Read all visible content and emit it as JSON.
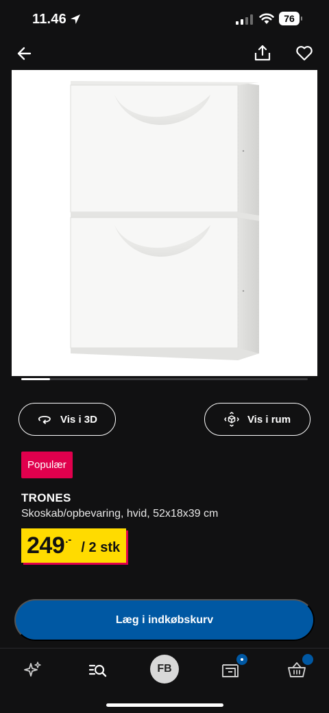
{
  "status": {
    "time": "11.46",
    "battery": "76"
  },
  "gallery": {
    "progress": 0.1
  },
  "actions": {
    "view_3d": "Vis i 3D",
    "view_room": "Vis i rum"
  },
  "product": {
    "badge": "Populær",
    "name": "TRONES",
    "description": "Skoskab/opbevaring, hvid, 52x18x39 cm",
    "price": "249",
    "price_suffix": ".-",
    "price_unit": "/ 2 stk"
  },
  "cart": {
    "label": "Læg i indkøbskurv"
  },
  "nav": {
    "account_initials": "FB"
  },
  "colors": {
    "accent_blue": "#0058a3",
    "badge_pink": "#e0004d",
    "price_yellow": "#ffdb00"
  }
}
